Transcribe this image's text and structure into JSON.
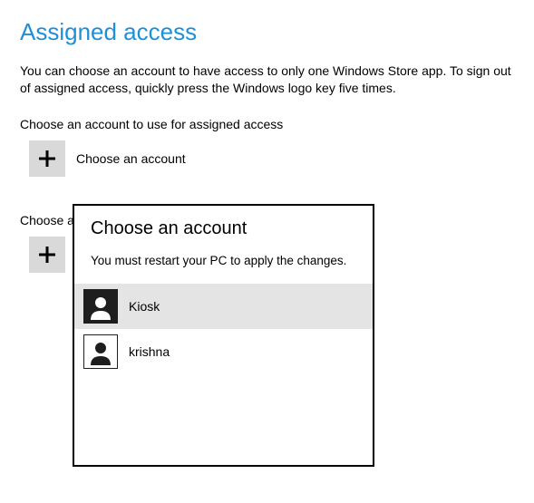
{
  "page": {
    "title": "Assigned access",
    "description": "You can choose an account to have access to only one Windows Store app. To sign out of assigned access, quickly press the Windows logo key five times.",
    "choose_account_label": "Choose an account to use for assigned access",
    "choose_account_button_text": "Choose an account",
    "choose_app_label_partial": "Choose a"
  },
  "popup": {
    "title": "Choose an account",
    "subtitle": "You must restart your PC to apply the changes.",
    "accounts": [
      {
        "name": "Kiosk",
        "selected": true
      },
      {
        "name": "krishna",
        "selected": false
      }
    ]
  }
}
